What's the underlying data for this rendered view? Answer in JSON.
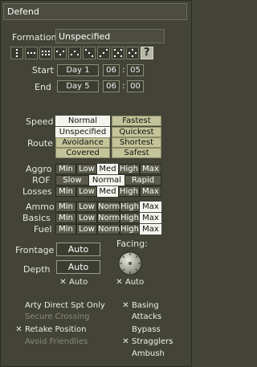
{
  "title": "Defend",
  "formation": {
    "label": "Formation",
    "value": "Unspecified",
    "help_glyph": "?"
  },
  "start": {
    "label": "Start",
    "day": "Day 1",
    "hour": "06",
    "sep": ":",
    "minute": "05"
  },
  "end": {
    "label": "End",
    "day": "Day 5",
    "hour": "06",
    "sep": ":",
    "minute": "00"
  },
  "speed": {
    "label": "Speed",
    "options": [
      "Normal",
      "Fastest"
    ],
    "selected": "Normal"
  },
  "route": {
    "label": "Route",
    "options": [
      "Unspecified",
      "Quickest",
      "Avoidance",
      "Shortest",
      "Covered",
      "Safest"
    ],
    "selected": "Unspecified"
  },
  "aggro": {
    "label": "Aggro",
    "options": [
      "Min",
      "Low",
      "Med",
      "High",
      "Max"
    ],
    "selected": "Med"
  },
  "rof": {
    "label": "ROF",
    "options": [
      "Slow",
      "Normal",
      "Rapid"
    ],
    "selected": "Normal"
  },
  "losses": {
    "label": "Losses",
    "options": [
      "Min",
      "Low",
      "Med",
      "High",
      "Max"
    ],
    "selected": "Med"
  },
  "ammo": {
    "label": "Ammo",
    "options": [
      "Min",
      "Low",
      "Norm",
      "High",
      "Max"
    ],
    "selected": "Max"
  },
  "basics": {
    "label": "Basics",
    "options": [
      "Min",
      "Low",
      "Norm",
      "High",
      "Max"
    ],
    "selected": "Max"
  },
  "fuel": {
    "label": "Fuel",
    "options": [
      "Min",
      "Low",
      "Norm",
      "High",
      "Max"
    ],
    "selected": "Max"
  },
  "frontage": {
    "label": "Frontage",
    "value": "Auto"
  },
  "depth": {
    "label": "Depth",
    "value": "Auto",
    "auto_check": "Auto"
  },
  "facing": {
    "label": "Facing:",
    "auto_check": "Auto"
  },
  "left_checks": [
    {
      "label": "Arty Direct Spt Only",
      "checked": false,
      "disabled": false
    },
    {
      "label": "Secure Crossing",
      "checked": false,
      "disabled": true
    },
    {
      "label": "Retake Position",
      "checked": true,
      "disabled": false
    },
    {
      "label": "Avoid Friendlies",
      "checked": false,
      "disabled": true
    }
  ],
  "right_checks": [
    {
      "label": "Basing",
      "checked": true
    },
    {
      "label": "Attacks",
      "checked": false
    },
    {
      "label": "Bypass",
      "checked": false
    },
    {
      "label": "Stragglers",
      "checked": true
    },
    {
      "label": "Ambush",
      "checked": false
    }
  ]
}
